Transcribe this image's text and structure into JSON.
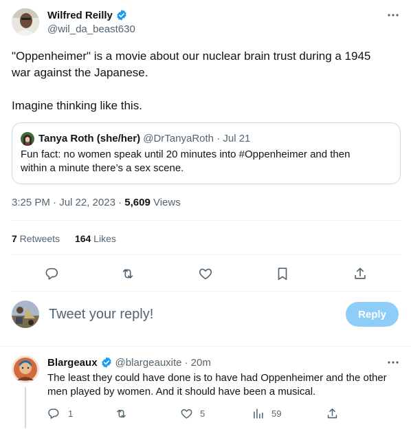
{
  "tweet": {
    "author_name": "Wilfred Reilly",
    "author_handle": "@wil_da_beast630",
    "text_line1": "\"Oppenheimer\" is a movie about our nuclear brain trust during a 1945",
    "text_line2": "war against the Japanese.",
    "text_line3": "Imagine thinking like this.",
    "time": "3:25 PM · Jul 22, 2023 · ",
    "views_count": "5,609",
    "views_label": " Views",
    "retweets_count": "7",
    "retweets_label": " Retweets",
    "likes_count": "164",
    "likes_label": " Likes"
  },
  "quote": {
    "author_name": "Tanya Roth (she/her)",
    "author_handle": "@DrTanyaRoth",
    "date": " · Jul 21",
    "text_line1": "Fun fact: no women speak until 20 minutes into #Oppenheimer and then",
    "text_line2": "within a minute there’s a sex scene."
  },
  "reply_box": {
    "placeholder": "Tweet your reply!",
    "button_label": "Reply"
  },
  "reply": {
    "author_name": "Blargeaux",
    "author_handle": "@blargeauxite",
    "time": " · 20m",
    "text_line1": "The least they could have done is to have had Oppenheimer and the other",
    "text_line2": "men played by women. And it should have been a musical.",
    "reply_count": "1",
    "like_count": "5",
    "view_count": "59"
  },
  "icons": {
    "more": "more-icon",
    "verified": "verified-badge-icon",
    "reply": "reply-icon",
    "retweet": "retweet-icon",
    "like": "heart-icon",
    "bookmark": "bookmark-icon",
    "share": "share-icon",
    "views": "views-icon"
  },
  "colors": {
    "accent": "#1d9bf0",
    "button_disabled": "#8ecdf8",
    "text_primary": "#0f1419",
    "text_secondary": "#536471",
    "border": "#cfd9de"
  }
}
